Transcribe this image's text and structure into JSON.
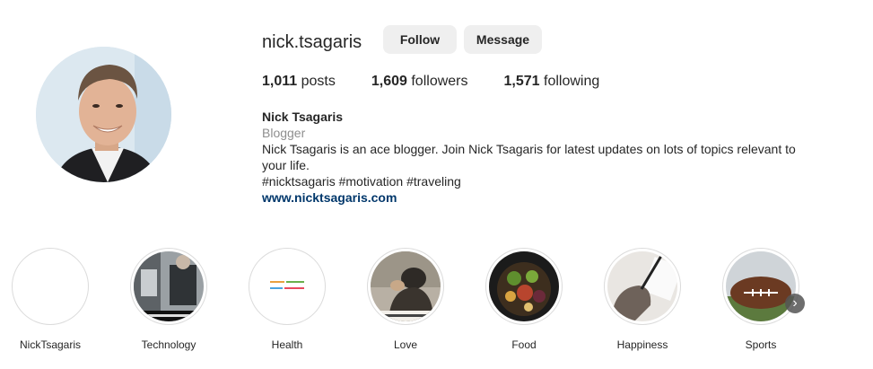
{
  "profile": {
    "username": "nick.tsagaris",
    "buttons": {
      "follow": "Follow",
      "message": "Message"
    },
    "stats": [
      {
        "count": "1,011",
        "label": "posts"
      },
      {
        "count": "1,609",
        "label": "followers"
      },
      {
        "count": "1,571",
        "label": "following"
      }
    ],
    "bio": {
      "name": "Nick Tsagaris",
      "category": "Blogger",
      "description": "Nick Tsagaris is an ace blogger. Join Nick Tsagaris for latest updates on lots of topics relevant to your life.",
      "hashtags": "#nicktsagaris #motivation #traveling",
      "link": "www.nicktsagaris.com"
    }
  },
  "highlights": [
    {
      "label": "NickTsagaris"
    },
    {
      "label": "Technology"
    },
    {
      "label": "Health"
    },
    {
      "label": "Love"
    },
    {
      "label": "Food"
    },
    {
      "label": "Happiness"
    },
    {
      "label": "Sports"
    }
  ],
  "colors": {
    "link": "#00376b",
    "secondary_text": "#8e8e8e",
    "button_bg": "#efefef"
  }
}
